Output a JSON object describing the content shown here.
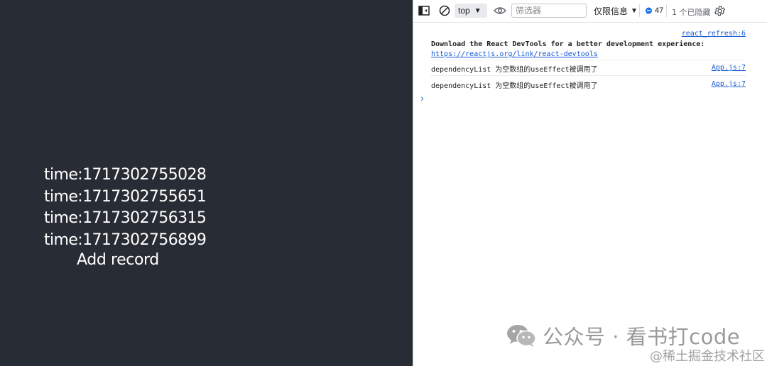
{
  "app": {
    "records": [
      "time:1717302755028",
      "time:1717302755651",
      "time:1717302756315",
      "time:1717302756899"
    ],
    "add_button_label": "Add record"
  },
  "devtools": {
    "toolbar": {
      "context_label": "top",
      "filter_placeholder": "筛选器",
      "levels_label": "仅限信息",
      "issues_count": "47",
      "hidden_label": "1 个已隐藏"
    },
    "messages": [
      {
        "source": "react_refresh:6",
        "text": "Download the React DevTools for a better development experience:",
        "link": "https://reactjs.org/link/react-devtools"
      },
      {
        "source": "App.js:7",
        "text": "dependencyList 为空数组的useEffect被调用了"
      },
      {
        "source": "App.js:7",
        "text": "dependencyList 为空数组的useEffect被调用了"
      }
    ],
    "prompt_symbol": "›"
  },
  "watermark": {
    "main": "公众号 · 看书打code",
    "sub": "@稀土掘金技术社区"
  },
  "colors": {
    "app_background": "#282c34",
    "accent_blue": "#1a73e8",
    "link_blue": "#1558d6"
  },
  "icons": [
    "sidebar-toggle-icon",
    "clear-console-icon",
    "caret-down-icon",
    "eye-icon",
    "issues-icon",
    "settings-gear-icon",
    "console-prompt-icon",
    "wechat-logo-icon"
  ]
}
